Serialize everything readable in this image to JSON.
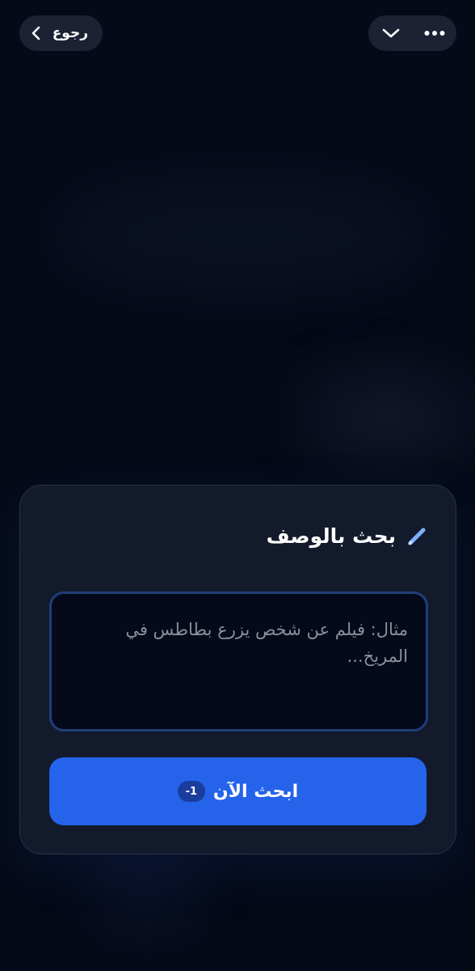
{
  "topbar": {
    "back_label": "رجوع",
    "back_icon": "chevron-right-icon",
    "collapse_icon": "chevron-down-icon",
    "more_icon": "more-horizontal-icon"
  },
  "card": {
    "title": "بحث بالوصف",
    "title_icon": "pencil-icon",
    "input": {
      "value": "",
      "placeholder": "مثال: فيلم عن شخص يزرع بطاطس في المريخ..."
    },
    "search_button": {
      "label": "ابحث الآن",
      "cost_badge": "-1"
    }
  },
  "colors": {
    "background": "#050a18",
    "card": "#121a2b",
    "accent": "#2563eb",
    "input_border": "#213d7a",
    "pill": "#1c2233"
  }
}
